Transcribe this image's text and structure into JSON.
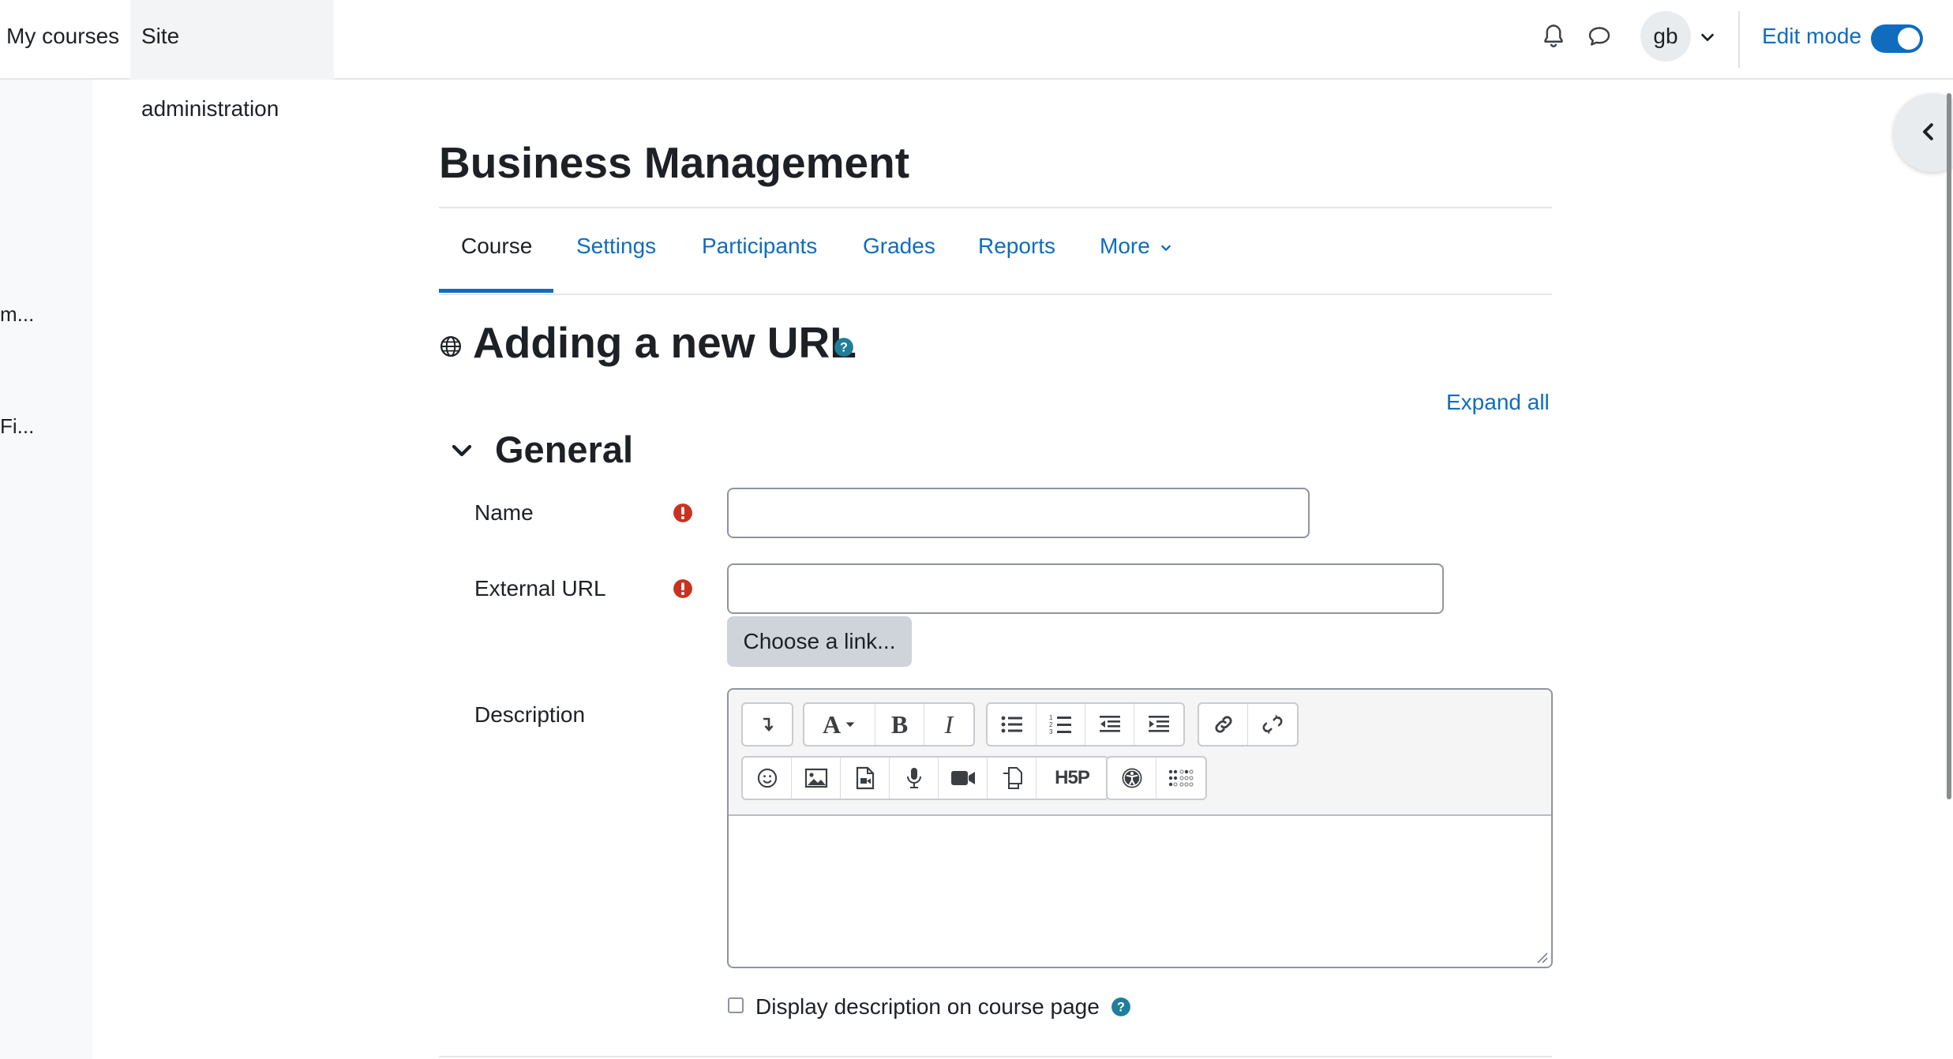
{
  "navbar": {
    "links": [
      {
        "label": "My courses",
        "active": false
      },
      {
        "label": "Site administration",
        "active": true
      }
    ],
    "notifications_icon": "bell-icon",
    "messages_icon": "chat-bubble-icon",
    "user_initials": "gb",
    "user_menu_icon": "chevron-down-icon",
    "edit_mode_label": "Edit mode",
    "edit_mode_on": true
  },
  "left_drawer": {
    "items": [
      "m...",
      "Fi..."
    ]
  },
  "course": {
    "title": "Business Management",
    "tabs": [
      {
        "label": "Course",
        "active": true
      },
      {
        "label": "Settings",
        "active": false
      },
      {
        "label": "Participants",
        "active": false
      },
      {
        "label": "Grades",
        "active": false
      },
      {
        "label": "Reports",
        "active": false
      },
      {
        "label": "More",
        "active": false
      }
    ]
  },
  "page": {
    "heading": "Adding a new URL",
    "heading_icon": "globe-icon",
    "expand_all_label": "Expand all"
  },
  "section": {
    "title": "General",
    "fields": {
      "name_label": "Name",
      "name_value": "",
      "url_label": "External URL",
      "url_value": "",
      "choose_link_label": "Choose a link...",
      "description_label": "Description",
      "description_value": "",
      "display_description_label": "Display description on course page",
      "display_description_checked": false
    }
  },
  "editor": {
    "row1_groups": [
      [
        "collapse-icon"
      ],
      [
        "font-style-icon",
        "bold-icon",
        "italic-icon"
      ],
      [
        "bullet-list-icon",
        "numbered-list-icon",
        "outdent-icon",
        "indent-icon"
      ],
      [
        "link-icon",
        "unlink-icon"
      ]
    ],
    "row2_groups": [
      [
        "emoji-icon",
        "image-icon",
        "media-icon",
        "record-audio-icon",
        "record-video-icon",
        "manage-files-icon",
        "h5p-icon"
      ],
      [
        "accessibility-checker-icon",
        "screenreader-helper-icon"
      ]
    ],
    "labels": {
      "bold": "B",
      "italic": "I",
      "font": "A",
      "h5p": "H5P"
    }
  },
  "colors": {
    "primary": "#0f6cbf",
    "required": "#ca3120",
    "help": "#1f7e9a",
    "text": "#1d2125"
  }
}
